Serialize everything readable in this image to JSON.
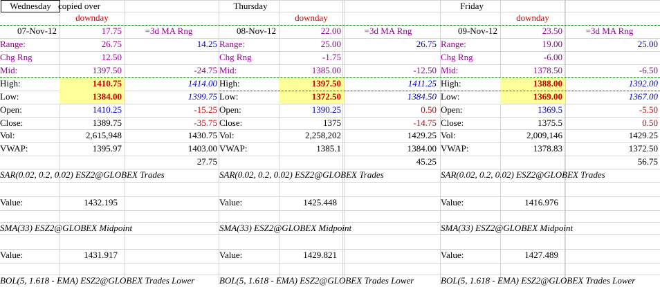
{
  "days": [
    {
      "name": "Wednesday",
      "note": "copied over",
      "tag": "downday",
      "date": "07-Nov-12",
      "day_range": "17.75",
      "ma_label": "=3d MA Rng",
      "range": "26.75",
      "range_ma": "14.25",
      "chg_rng": "12.50",
      "mid": "1397.50",
      "mid_chg": "-24.75",
      "high": "1410.75",
      "high_ref": "1414.00",
      "low": "1384.00",
      "low_ref": "1399.75",
      "open": "1410.25",
      "open_chg": "-15.25",
      "close": "1389.75",
      "close_chg": "-35.75",
      "vol": "2,615,948",
      "vol_ref": "1430.75",
      "vwap": "1395.97",
      "vwap_ref": "1403.00",
      "extra": "27.75",
      "sar_title": "SAR(0.02, 0.2, 0.02) ESZ2@GLOBEX Trades",
      "sar_value": "1432.195",
      "sma_title": "SMA(33) ESZ2@GLOBEX Midpoint",
      "sma_value": "1431.917",
      "bol_title": "BOL(5, 1.618 - EMA) ESZ2@GLOBEX Trades Lower"
    },
    {
      "name": "Thursday",
      "note": "",
      "tag": "downday",
      "date": "08-Nov-12",
      "day_range": "22.00",
      "ma_label": "=3d MA Rng",
      "range": "25.00",
      "range_ma": "26.75",
      "chg_rng": "-1.75",
      "mid": "1385.00",
      "mid_chg": "-12.50",
      "high": "1397.50",
      "high_ref": "1411.25",
      "low": "1372.50",
      "low_ref": "1384.50",
      "open": "1390.25",
      "open_chg": "0.50",
      "close": "1375",
      "close_chg": "-14.75",
      "vol": "2,258,202",
      "vol_ref": "1429.25",
      "vwap": "1385.1",
      "vwap_ref": "1384.00",
      "extra": "45.25",
      "sar_title": "SAR(0.02, 0.2, 0.02) ESZ2@GLOBEX Trades",
      "sar_value": "1425.448",
      "sma_title": "SMA(33) ESZ2@GLOBEX Midpoint",
      "sma_value": "1429.821",
      "bol_title": "BOL(5, 1.618 - EMA) ESZ2@GLOBEX Trades Lower"
    },
    {
      "name": "Friday",
      "note": "",
      "tag": "downday",
      "date": "09-Nov-12",
      "day_range": "23.50",
      "ma_label": "=3d MA Rng",
      "range": "19.00",
      "range_ma": "25.00",
      "chg_rng": "-6.00",
      "mid": "1378.50",
      "mid_chg": "-6.50",
      "high": "1388.00",
      "high_ref": "1392.00",
      "low": "1369.00",
      "low_ref": "1367.00",
      "open": "1369.5",
      "open_chg": "-5.50",
      "close": "1375.5",
      "close_chg": "0.50",
      "vol": "2,009,146",
      "vol_ref": "1429.25",
      "vwap": "1378.83",
      "vwap_ref": "1372.50",
      "extra": "56.75",
      "sar_title": "SAR(0.02, 0.2, 0.02) ESZ2@GLOBEX Trades",
      "sar_value": "1416.976",
      "sma_title": "SMA(33) ESZ2@GLOBEX Midpoint",
      "sma_value": "1427.489",
      "bol_title": "BOL(5, 1.618 - EMA) ESZ2@GLOBEX Trades Lower"
    }
  ],
  "labels": {
    "range": "Range:",
    "chg_rng": "Chg Rng",
    "mid": "Mid:",
    "high": "High:",
    "low": "Low:",
    "open": "Open:",
    "close": "Close:",
    "vol": "Vol:",
    "vwap": "VWAP:",
    "value": "Value:"
  },
  "colors": {
    "highlight": "#ffff99",
    "downday": "#cc0000",
    "purple": "#990099",
    "blue": "#0000cc",
    "dash": "#008000"
  }
}
